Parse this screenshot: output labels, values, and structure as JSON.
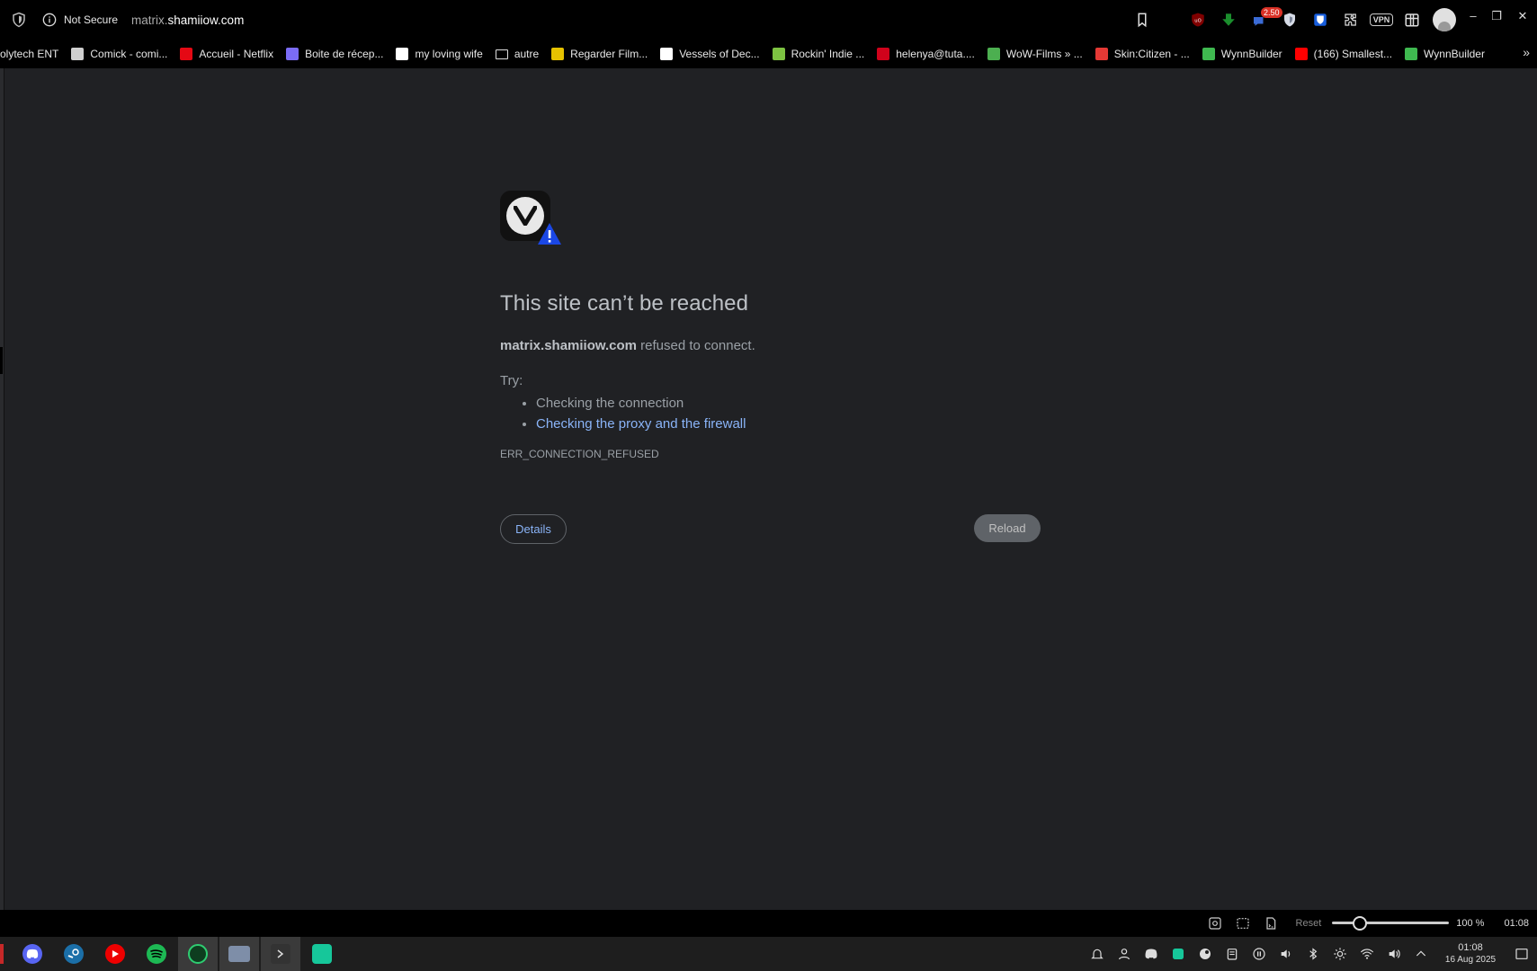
{
  "addressbar": {
    "security_label": "Not Secure",
    "url_prefix": "matrix.",
    "url_domain": "shamiiow.com",
    "badge_count": "2.50",
    "vpn_label": "VPN"
  },
  "bookmarks": [
    {
      "label": "olytech ENT",
      "color": "#000000"
    },
    {
      "label": "Comick - comi...",
      "color": "#cfcfcf"
    },
    {
      "label": "Accueil - Netflix",
      "color": "#e50914"
    },
    {
      "label": "Boite de récep...",
      "color": "#7b6cf6"
    },
    {
      "label": "my loving wife",
      "color": "#ffffff"
    },
    {
      "label": "autre",
      "color": "folder"
    },
    {
      "label": "Regarder Film...",
      "color": "#e6c200"
    },
    {
      "label": "Vessels of Dec...",
      "color": "#ffffff"
    },
    {
      "label": "Rockin' Indie ...",
      "color": "#7dc242"
    },
    {
      "label": "helenya@tuta....",
      "color": "#d0021b"
    },
    {
      "label": "WoW-Films » ...",
      "color": "#4caf50"
    },
    {
      "label": "Skin:Citizen - ...",
      "color": "#e53935"
    },
    {
      "label": "WynnBuilder",
      "color": "#3fb950"
    },
    {
      "label": "(166) Smallest...",
      "color": "#ff0000"
    },
    {
      "label": "WynnBuilder",
      "color": "#3fb950"
    }
  ],
  "error": {
    "title": "This site can’t be reached",
    "host": "matrix.shamiiow.com",
    "message": " refused to connect.",
    "try_label": "Try:",
    "suggestions": [
      "Checking the connection",
      "Checking the proxy and the firewall"
    ],
    "code": "ERR_CONNECTION_REFUSED",
    "details_label": "Details",
    "reload_label": "Reload"
  },
  "statusbar": {
    "reset_label": "Reset",
    "zoom_label": "100 %",
    "zoom_value": 0.2,
    "time": "01:08"
  },
  "taskbar": {
    "time": "01:08",
    "date": "16 Aug 2025"
  }
}
